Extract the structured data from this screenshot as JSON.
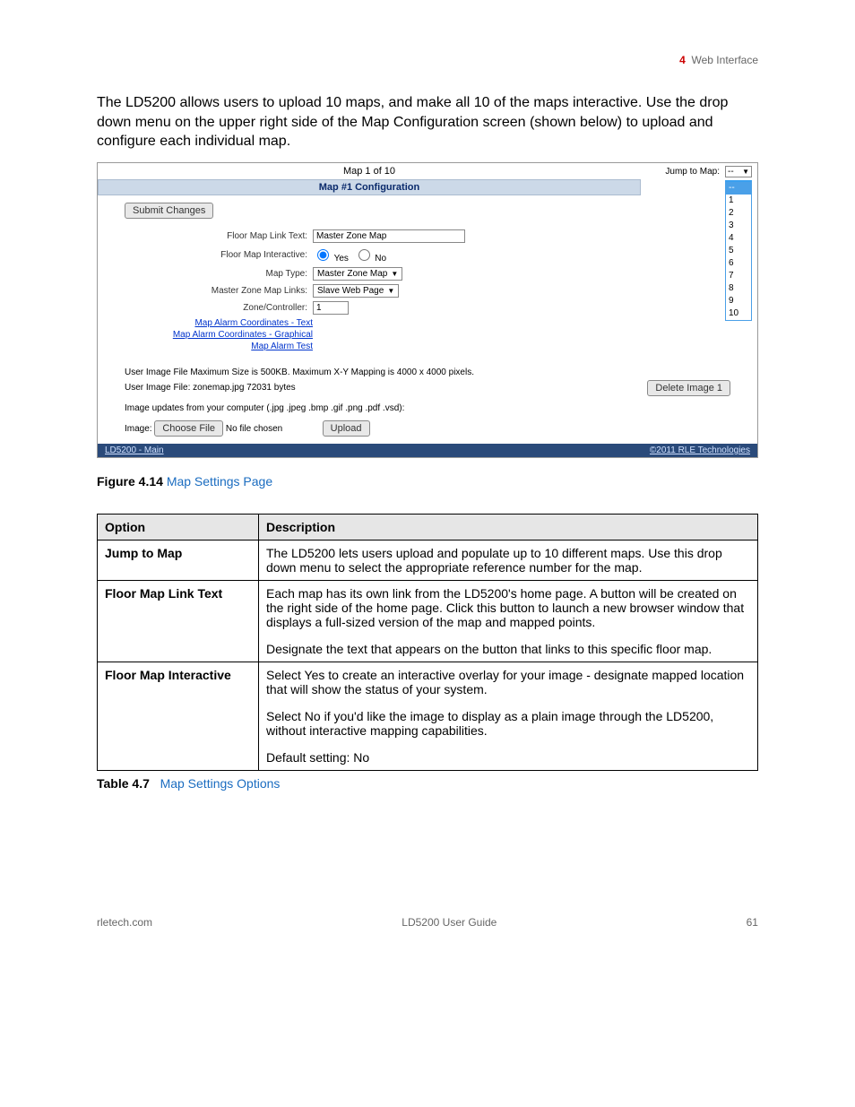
{
  "header": {
    "chapnum": "4",
    "chapname": "Web Interface"
  },
  "intro": "The LD5200 allows users to upload 10 maps, and make all 10 of the maps interactive. Use the drop down menu on the upper right side of the Map Configuration screen (shown below) to upload and configure each individual map.",
  "scr": {
    "map_of": "Map 1 of 10",
    "config_title": "Map #1 Configuration",
    "submit": "Submit Changes",
    "rows": {
      "linktext_label": "Floor Map Link Text:",
      "linktext_value": "Master Zone Map",
      "interactive_label": "Floor Map Interactive:",
      "interactive_yes": "Yes",
      "interactive_no": "No",
      "maptype_label": "Map Type:",
      "maptype_value": "Master Zone Map",
      "mzml_label": "Master Zone Map Links:",
      "mzml_value": "Slave Web Page",
      "zone_label": "Zone/Controller:",
      "zone_value": "1"
    },
    "links": {
      "a": "Map Alarm Coordinates - Text",
      "b": "Map Alarm Coordinates - Graphical",
      "c": "Map Alarm Test"
    },
    "lower": {
      "maxsize": "User Image File Maximum Size is 500KB. Maximum X-Y Mapping is 4000 x 4000 pixels.",
      "fileinfo": "User Image File: zonemap.jpg 72031 bytes",
      "delete": "Delete Image 1",
      "updates": "Image updates from your computer (.jpg .jpeg .bmp .gif .png .pdf .vsd):",
      "imagelbl": "Image:",
      "choose": "Choose File",
      "nofile": "No file chosen",
      "upload": "Upload"
    },
    "footer": {
      "left": "LD5200 - Main",
      "right": "©2011 RLE Technologies"
    },
    "jump": {
      "label": "Jump to Map:",
      "sel": "--",
      "options": [
        "--",
        "1",
        "2",
        "3",
        "4",
        "5",
        "6",
        "7",
        "8",
        "9",
        "10"
      ]
    }
  },
  "figure": {
    "label": "Figure 4.14",
    "title": "Map Settings Page"
  },
  "table": {
    "hdr_option": "Option",
    "hdr_desc": "Description",
    "rows": [
      {
        "opt": "Jump to Map",
        "desc1": "The LD5200 lets users upload and populate up to 10 different maps. Use this drop down menu to select the appropriate reference number for the map."
      },
      {
        "opt": "Floor Map Link Text",
        "desc1": "Each map has its own link from the LD5200's home page. A button will be created on the right side of the home page. Click this button to launch a new browser window that displays a full-sized version of the map and mapped points.",
        "desc2": "Designate the text that appears on the button that links to this specific floor map."
      },
      {
        "opt": "Floor Map Interactive",
        "desc1": "Select Yes to create an interactive overlay for your image - designate mapped location that will show the status of your system.",
        "desc2": "Select No if you'd like the image to display as a plain image through the LD5200, without interactive mapping capabilities.",
        "desc3": "Default setting: No"
      }
    ]
  },
  "tablecap": {
    "label": "Table 4.7",
    "title": "Map Settings Options"
  },
  "footer": {
    "left": "rletech.com",
    "center": "LD5200 User Guide",
    "right": "61"
  }
}
